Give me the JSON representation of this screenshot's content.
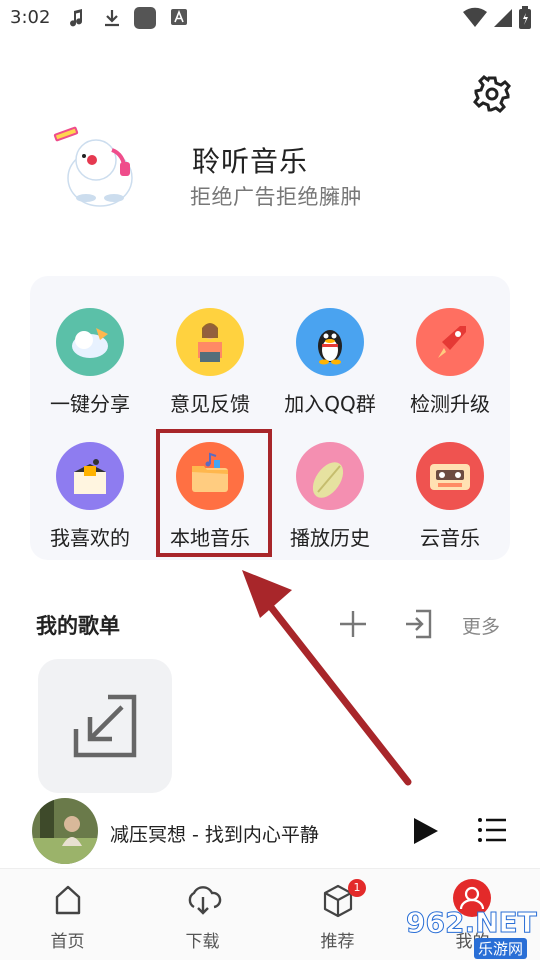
{
  "status_bar": {
    "time": "3:02"
  },
  "header": {
    "title": "聆听音乐",
    "subtitle": "拒绝广告拒绝臃肿",
    "icons": [
      "moon-icon",
      "settings-icon"
    ]
  },
  "features": [
    {
      "label": "一键分享",
      "icon": "share-icon",
      "color": "#5bc0a8"
    },
    {
      "label": "意见反馈",
      "icon": "feedback-icon",
      "color": "#ffd23f"
    },
    {
      "label": "加入QQ群",
      "icon": "qq-icon",
      "color": "#4aa3f0"
    },
    {
      "label": "检测升级",
      "icon": "rocket-icon",
      "color": "#ff6f61"
    },
    {
      "label": "我喜欢的",
      "icon": "favorite-box-icon",
      "color": "#8e7cf0"
    },
    {
      "label": "本地音乐",
      "icon": "folder-music-icon",
      "color": "#ff7043"
    },
    {
      "label": "播放历史",
      "icon": "history-icon",
      "color": "#f48fb1"
    },
    {
      "label": "云音乐",
      "icon": "cassette-icon",
      "color": "#ef5350"
    }
  ],
  "playlists": {
    "title": "我的歌单",
    "more_label": "更多",
    "tile_icon": "import-icon"
  },
  "now_playing": {
    "title": "减压冥想 - 找到内心平静"
  },
  "bottom_nav": [
    {
      "label": "首页",
      "icon": "home-icon"
    },
    {
      "label": "下载",
      "icon": "cloud-download-icon"
    },
    {
      "label": "推荐",
      "icon": "cube-icon",
      "badge": "1"
    },
    {
      "label": "我的",
      "icon": "user-icon"
    }
  ],
  "watermark": {
    "main": "962.NET",
    "sub": "乐游网"
  },
  "colors": {
    "accent": "#e32a2a",
    "highlight": "#a8262a",
    "arrow": "#a8262a"
  }
}
